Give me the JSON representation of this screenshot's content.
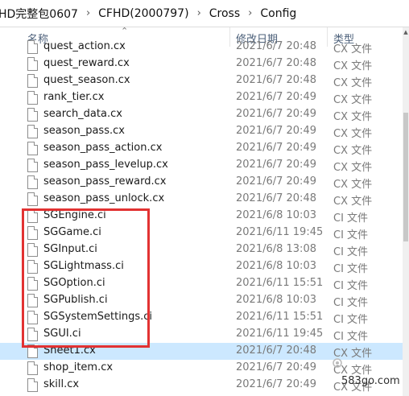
{
  "breadcrumb": [
    "HD完整包0607",
    "CFHD(2000797)",
    "Cross",
    "Config"
  ],
  "columns": {
    "name": "名称",
    "date": "修改日期",
    "type": "类型"
  },
  "files": [
    {
      "name": "quest_action.cx",
      "date": "2021/6/7 20:48",
      "type": "CX 文件"
    },
    {
      "name": "quest_reward.cx",
      "date": "2021/6/7 20:48",
      "type": "CX 文件"
    },
    {
      "name": "quest_season.cx",
      "date": "2021/6/7 20:48",
      "type": "CX 文件"
    },
    {
      "name": "rank_tier.cx",
      "date": "2021/6/7 20:49",
      "type": "CX 文件"
    },
    {
      "name": "search_data.cx",
      "date": "2021/6/7 20:49",
      "type": "CX 文件"
    },
    {
      "name": "season_pass.cx",
      "date": "2021/6/7 20:49",
      "type": "CX 文件"
    },
    {
      "name": "season_pass_action.cx",
      "date": "2021/6/7 20:49",
      "type": "CX 文件"
    },
    {
      "name": "season_pass_levelup.cx",
      "date": "2021/6/7 20:49",
      "type": "CX 文件"
    },
    {
      "name": "season_pass_reward.cx",
      "date": "2021/6/7 20:49",
      "type": "CX 文件"
    },
    {
      "name": "season_pass_unlock.cx",
      "date": "2021/6/7 20:48",
      "type": "CX 文件"
    },
    {
      "name": "SGEngine.ci",
      "date": "2021/6/8 10:03",
      "type": "CI 文件"
    },
    {
      "name": "SGGame.ci",
      "date": "2021/6/11 19:45",
      "type": "CI 文件"
    },
    {
      "name": "SGInput.ci",
      "date": "2021/6/8 13:08",
      "type": "CI 文件"
    },
    {
      "name": "SGLightmass.ci",
      "date": "2021/6/8 10:03",
      "type": "CI 文件"
    },
    {
      "name": "SGOption.ci",
      "date": "2021/6/11 15:51",
      "type": "CI 文件"
    },
    {
      "name": "SGPublish.ci",
      "date": "2021/6/8 10:03",
      "type": "CI 文件"
    },
    {
      "name": "SGSystemSettings.ci",
      "date": "2021/6/11 15:51",
      "type": "CI 文件"
    },
    {
      "name": "SGUI.ci",
      "date": "2021/6/11 19:45",
      "type": "CI 文件"
    },
    {
      "name": "Sheet1.cx",
      "date": "2021/6/7 20:48",
      "type": "CX 文件",
      "selected": true
    },
    {
      "name": "shop_item.cx",
      "date": "2021/6/7 20:49",
      "type": "CX 文件"
    },
    {
      "name": "skill.cx",
      "date": "2021/6/7 20:49",
      "type": "CX 文件"
    }
  ],
  "watermark": "583go.com",
  "colors": {
    "selection": "#cce8ff",
    "highlight_border": "#e23232",
    "header_text": "#4c607a"
  }
}
